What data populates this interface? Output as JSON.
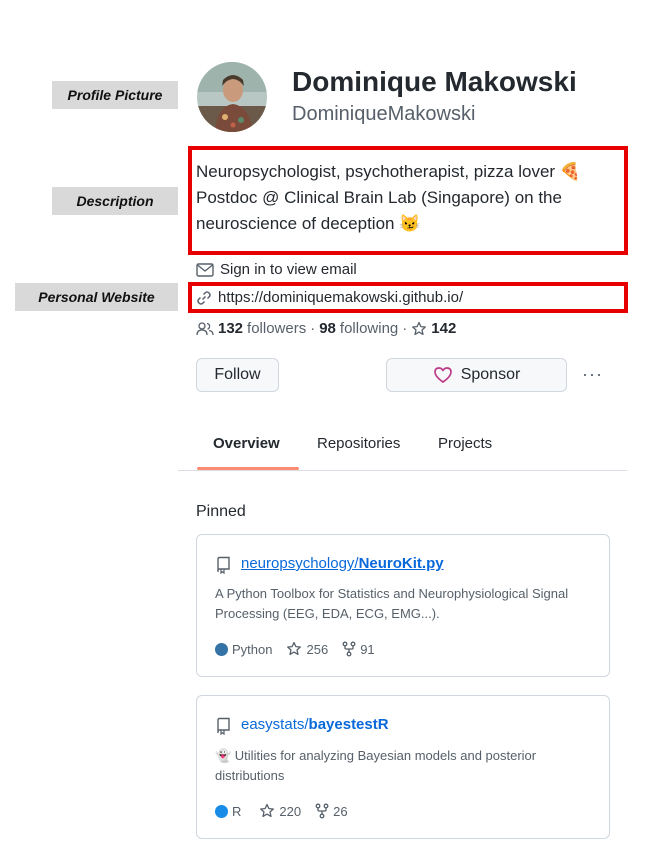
{
  "annotations": {
    "profile_picture": "Profile Picture",
    "description": "Description",
    "personal_website": "Personal Website"
  },
  "profile": {
    "name": "Dominique Makowski",
    "username": "DominiqueMakowski",
    "bio_lines": [
      "Neuropsychologist, psychotherapist, pizza lover 🍕",
      "Postdoc @ Clinical Brain Lab (Singapore) on the",
      "neuroscience of deception 😼"
    ],
    "email_text": "Sign in to view email",
    "website": "https://dominiquemakowski.github.io/",
    "followers_count": "132",
    "followers_label": "followers",
    "separator": "·",
    "following_count": "98",
    "following_label": "following",
    "separator2": "·",
    "stars_count": "142"
  },
  "buttons": {
    "follow": "Follow",
    "sponsor": "Sponsor",
    "more": "···"
  },
  "tabs": [
    {
      "label": "Overview",
      "active": true
    },
    {
      "label": "Repositories",
      "active": false
    },
    {
      "label": "Projects",
      "active": false
    }
  ],
  "pinned": {
    "title": "Pinned",
    "repos": [
      {
        "owner": "neuropsychology/",
        "name": "NeuroKit.py",
        "description": "A Python Toolbox for Statistics and Neurophysiological Signal Processing (EEG, EDA, ECG, EMG...).",
        "language": "Python",
        "language_color": "#3572A5",
        "stars": "256",
        "forks": "91"
      },
      {
        "owner": "easystats/",
        "name": "bayestestR",
        "description": "👻 Utilities for analyzing Bayesian models and posterior distributions",
        "language": "R",
        "language_color": "#198CE7",
        "stars": "220",
        "forks": "26"
      }
    ]
  },
  "colors": {
    "annotation_box": "#e60000",
    "tab_underline": "#fd8c73",
    "link": "#0969da",
    "sponsor_heart": "#bf3989"
  }
}
